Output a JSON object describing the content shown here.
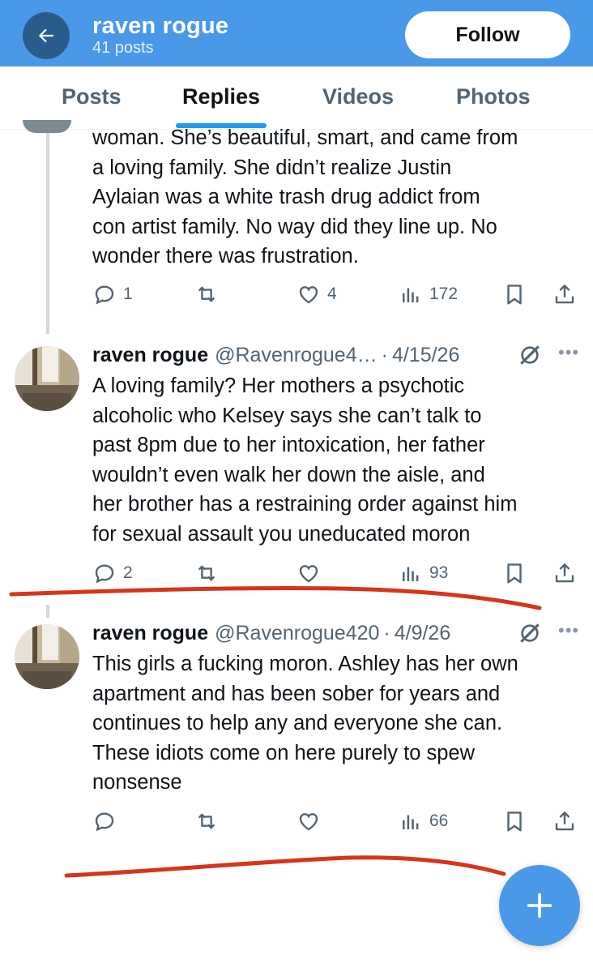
{
  "header": {
    "name": "raven rogue",
    "post_count": "41 posts",
    "follow_label": "Follow"
  },
  "tabs": [
    {
      "label": "Posts",
      "active": false
    },
    {
      "label": "Replies",
      "active": true
    },
    {
      "label": "Videos",
      "active": false
    },
    {
      "label": "Photos",
      "active": false
    }
  ],
  "tweets": [
    {
      "text_lines": [
        "woman. She’s beautiful, smart, and came from",
        "a loving family. She didn’t realize Justin",
        "Aylaian was a white trash drug addict from",
        "con artist family. No way did they line up. No",
        "wonder there was frustration."
      ],
      "replies": "1",
      "reposts": "",
      "likes": "4",
      "views": "172"
    },
    {
      "name": "raven rogue",
      "handle": "@Ravenrogue4…",
      "date": "4/15/26",
      "text_lines": [
        "A loving family? Her mothers a psychotic",
        "alcoholic who Kelsey says she can’t talk to",
        "past 8pm due to her intoxication, her father",
        "wouldn’t even walk her down the aisle, and",
        "her brother has a restraining order against him",
        "for sexual assault you uneducated moron"
      ],
      "replies": "2",
      "reposts": "",
      "likes": "",
      "views": "93"
    },
    {
      "name": "raven rogue",
      "handle": "@Ravenrogue420",
      "date": "4/9/26",
      "text_lines": [
        "This girls a fucking moron. Ashley has her own",
        "apartment and has been sober for years and",
        "continues to help any and everyone she can.",
        "These idiots come on here purely to spew",
        "nonsense"
      ],
      "replies": "",
      "reposts": "",
      "likes": "",
      "views": "66"
    }
  ],
  "colors": {
    "header_bg": "#4a99e9",
    "accent": "#1d9bf0",
    "annotation_red": "#d4361c"
  },
  "icons": [
    "back-arrow-icon",
    "reply-icon",
    "repost-icon",
    "like-icon",
    "views-icon",
    "bookmark-icon",
    "share-icon",
    "grok-icon",
    "more-icon",
    "compose-plus-icon"
  ]
}
